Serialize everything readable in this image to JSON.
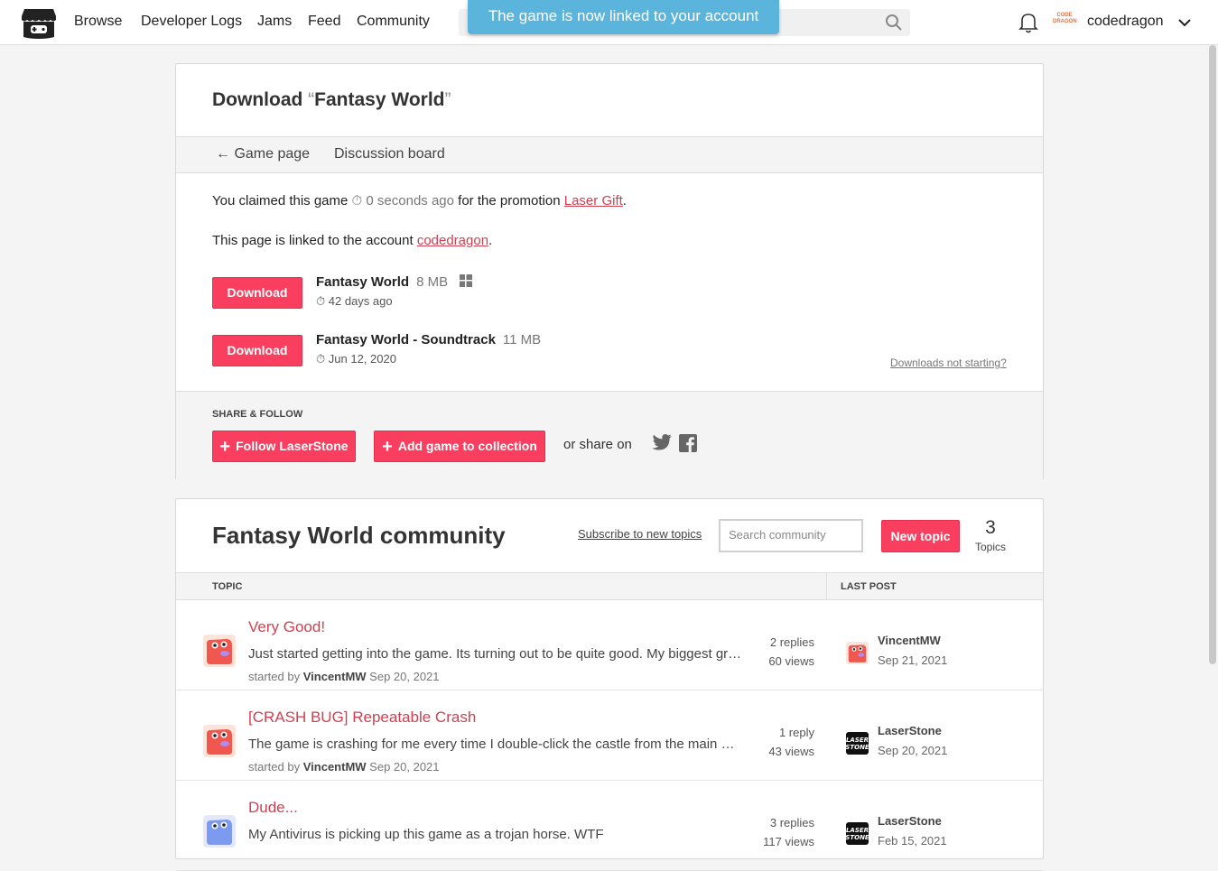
{
  "nav": {
    "items": [
      "Browse",
      "Developer Logs",
      "Jams",
      "Feed",
      "Community"
    ],
    "username": "codedragon",
    "avatar_text": "CODE DRAGON"
  },
  "toast": {
    "message": "The game is now linked to your account"
  },
  "download": {
    "title_prefix": "Download ",
    "open_quote": "“",
    "game_name": "Fantasy World",
    "close_quote": "”",
    "subnav": {
      "game_page": "Game page",
      "discussion_board": "Discussion board"
    },
    "claimed": {
      "prefix": "You claimed this game",
      "time": "0 seconds ago",
      "mid": "for the promotion",
      "promotion": "Laser Gift",
      "suffix": "."
    },
    "linked": {
      "prefix": "This page is linked to the account",
      "account": "codedragon",
      "suffix": "."
    },
    "files": [
      {
        "button": "Download",
        "name": "Fantasy World",
        "size": "8 MB",
        "date": "42 days ago",
        "platform": "windows-icon"
      },
      {
        "button": "Download",
        "name": "Fantasy World - Soundtrack",
        "size": "11 MB",
        "date": "Jun 12, 2020"
      }
    ],
    "help_link": "Downloads not starting?",
    "share": {
      "heading": "SHARE & FOLLOW",
      "follow_label": "Follow LaserStone",
      "collection_label": "Add game to collection",
      "share_text": "or share on"
    }
  },
  "community": {
    "title": "Fantasy World community",
    "subscribe": "Subscribe to new topics",
    "search_placeholder": "Search community",
    "new_topic": "New topic",
    "topic_count": "3",
    "topic_count_label": "Topics",
    "headers": {
      "topic": "TOPIC",
      "last_post": "LAST POST"
    },
    "topics": [
      {
        "title": "Very Good!",
        "excerpt": "Just started getting into the game. Its turning out to be quite good. My biggest gripe so far is the difficulty spikes.",
        "started_prefix": "started by",
        "author": "VincentMW",
        "date": "Sep 20, 2021",
        "replies": "2 replies",
        "views": "60 views",
        "last_user": "VincentMW",
        "last_date": "Sep 21, 2021"
      },
      {
        "title": "[CRASH BUG] Repeatable Crash",
        "excerpt": "The game is crashing for me every time I double-click the castle from the main map screen.",
        "started_prefix": "started by",
        "author": "VincentMW",
        "date": "Sep 20, 2021",
        "replies": "1 reply",
        "views": "43 views",
        "last_user": "LaserStone",
        "last_date": "Sep 20, 2021"
      },
      {
        "title": "Dude...",
        "excerpt": "My Antivirus is picking up this game as a trojan horse. WTF",
        "replies": "3 replies",
        "views": "117 views",
        "last_user": "LaserStone",
        "last_date": "Feb 15, 2021"
      }
    ]
  },
  "colors": {
    "accent": "#fa3e5f",
    "link": "#d04050",
    "toast": "#5ab4dc"
  }
}
